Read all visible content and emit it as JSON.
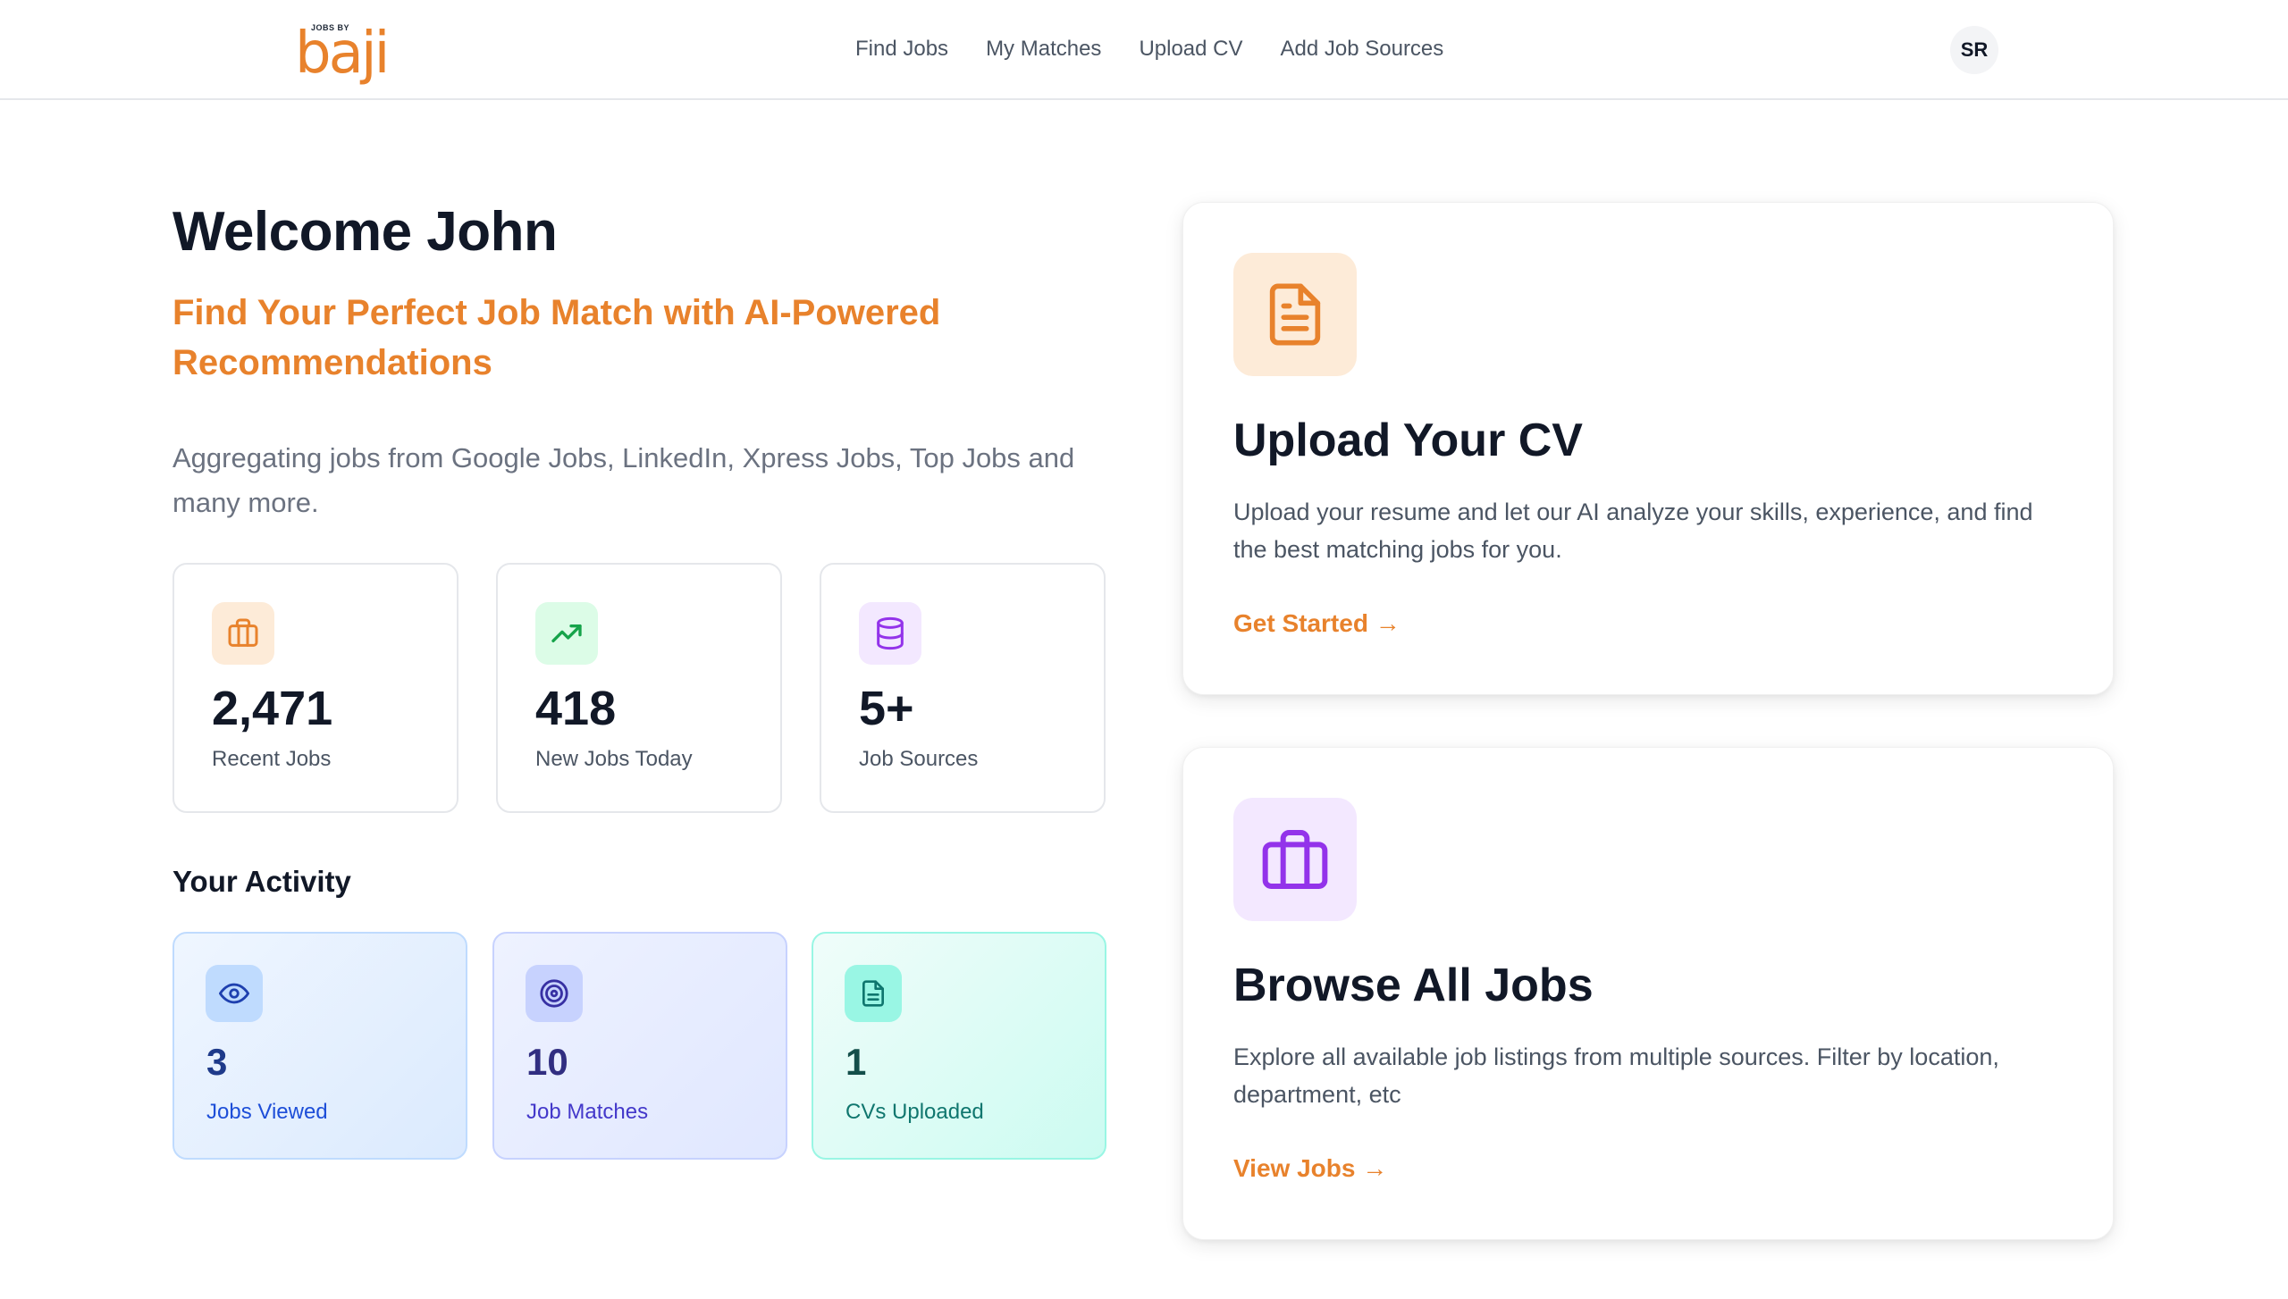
{
  "header": {
    "logo": {
      "small_text": "JOBS BY",
      "word": "baji"
    },
    "nav": [
      "Find Jobs",
      "My Matches",
      "Upload CV",
      "Add Job Sources"
    ],
    "avatar_initials": "SR"
  },
  "hero": {
    "welcome": "Welcome John",
    "tagline": "Find Your Perfect Job Match with AI-Powered Recommendations",
    "aggregating": "Aggregating jobs from Google Jobs, LinkedIn, Xpress Jobs, Top Jobs and many more."
  },
  "stats": [
    {
      "icon": "briefcase-icon",
      "value": "2,471",
      "label": "Recent Jobs",
      "color": "#e8822c",
      "bg": "#fdebd8"
    },
    {
      "icon": "trending-up-icon",
      "value": "418",
      "label": "New Jobs Today",
      "color": "#16a34a",
      "bg": "#dcfce7"
    },
    {
      "icon": "database-icon",
      "value": "5+",
      "label": "Job Sources",
      "color": "#9333ea",
      "bg": "#f3e8ff"
    }
  ],
  "activity": {
    "title": "Your Activity",
    "items": [
      {
        "icon": "eye-icon",
        "value": "3",
        "label": "Jobs Viewed"
      },
      {
        "icon": "target-icon",
        "value": "10",
        "label": "Job Matches"
      },
      {
        "icon": "file-icon",
        "value": "1",
        "label": "CVs Uploaded"
      }
    ]
  },
  "features": [
    {
      "icon": "document-icon",
      "title": "Upload Your CV",
      "description": "Upload your resume and let our AI analyze your skills, experience, and find the best matching jobs for you.",
      "cta": "Get Started →"
    },
    {
      "icon": "briefcase-icon",
      "title": "Browse All Jobs",
      "description": "Explore all available job listings from multiple sources. Filter by location, department, etc",
      "cta": "View Jobs →"
    }
  ],
  "colors": {
    "accent": "#e8822c",
    "purple": "#9333ea",
    "green": "#16a34a",
    "blue": "#1e40af",
    "indigo": "#3730a3",
    "teal": "#0f766e"
  }
}
